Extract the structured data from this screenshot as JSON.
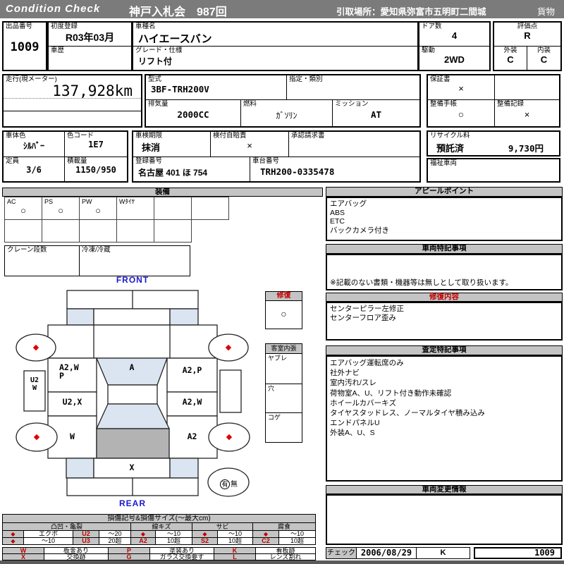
{
  "header": {
    "brand": "Condition  Check",
    "auction": "神戸入札会　987回",
    "pickup": "引取場所：愛知県弥富市五明町二間城",
    "category": "貨物"
  },
  "info": {
    "lot_label": "出品番号",
    "lot_no": "1009",
    "first_reg_label": "初度登録",
    "first_reg": "R03年03月",
    "history_label": "車歴",
    "history": "",
    "model_name_label": "車種名",
    "model_name": "ハイエースバン",
    "grade_label": "グレード・仕様",
    "grade": "リフト付",
    "doors_label": "ドア数",
    "doors": "4",
    "drive_label": "駆動",
    "drive": "2WD",
    "score_label": "評価点",
    "score": "R",
    "exterior_label": "外装",
    "exterior": "C",
    "interior_label": "内装",
    "interior": "C",
    "mileage_label": "走行(現メーター)",
    "mileage": "137,928km",
    "model_code_label": "型式",
    "model_code": "3BF-TRH200V",
    "designation_label": "指定・類別",
    "designation": "",
    "displacement_label": "排気量",
    "displacement": "2000CC",
    "fuel_label": "燃料",
    "fuel": "ｶﾞｿﾘﾝ",
    "transmission_label": "ミッション",
    "transmission": "AT",
    "warranty_label": "保証書",
    "warranty": "×",
    "maintenance_book_label": "整備手帳",
    "maintenance_book": "○",
    "maintenance_record_label": "整備記録",
    "maintenance_record": "×",
    "body_color_label": "車体色",
    "body_color": "ｼﾙﾊﾞｰ",
    "color_code_label": "色コード",
    "color_code": "1E7",
    "inspection_label": "車検期限",
    "inspection": "抹消",
    "insurance_label": "検付自賠責",
    "insurance": "×",
    "approval_label": "承認請求書",
    "approval": "",
    "capacity_label": "定員",
    "capacity": "3/6",
    "load_label": "積載量",
    "load": "1150/950",
    "reg_no_label": "登録番号",
    "reg_no": "名古屋 401 ほ 754",
    "chassis_label": "車台番号",
    "chassis": "TRH200-0335478",
    "recycle_label": "リサイクル料",
    "recycle_status": "預託済",
    "recycle_fee": "9,730円",
    "welfare_label": "福祉車両",
    "welfare": ""
  },
  "equipment": {
    "title": "装備",
    "row1": [
      {
        "label": "AC",
        "value": "○"
      },
      {
        "label": "PS",
        "value": "○"
      },
      {
        "label": "PW",
        "value": "○"
      },
      {
        "label": "Wﾀｲﾔ",
        "value": ""
      },
      {
        "label": "",
        "value": ""
      },
      {
        "label": "",
        "value": ""
      }
    ],
    "crane_label": "クレーン段数",
    "fridge_label": "冷凍/冷蔵"
  },
  "diagram": {
    "front_label": "FRONT",
    "rear_label": "REAR",
    "wheel_mark": "◆",
    "panels": {
      "windshield": "A",
      "front_door_left_line1": "A2,W",
      "front_door_left_line2": "P",
      "front_door_right": "A2,P",
      "rocker_left_line1": "U2",
      "rocker_left_line2": "W",
      "slide_left": "U2,X",
      "slide_right": "A2,W",
      "quarter_left": "W",
      "quarter_right": "A2",
      "rear_center": "X"
    },
    "repair": {
      "title": "修復",
      "value": "○"
    },
    "cabin": {
      "title": "客室内張",
      "row1": "ヤブレ",
      "row2": "穴",
      "row3": "コゲ"
    },
    "lift": {
      "yes": "有",
      "no": "無"
    }
  },
  "right": {
    "appeal": {
      "title": "アピールポイント",
      "lines": [
        "エアバッグ",
        "ABS",
        "ETC",
        "バックカメラ付き"
      ]
    },
    "notes": {
      "title": "車両特記事項",
      "note": "※記載のない書類・機器等は無しとして取り扱います。"
    },
    "repair_detail": {
      "title": "修復内容",
      "lines": [
        "センターピラー左修正",
        "センターフロア歪み"
      ]
    },
    "assessment": {
      "title": "査定特記事項",
      "lines": [
        "エアバッグ運転席のみ",
        "社外ナビ",
        "室内汚れ/スレ",
        "荷物室A、U、リフト付き動作未確認",
        "ホイールカバーキズ",
        "タイヤスタッドレス、ノーマルタイヤ積み込み",
        "エンドパネルU",
        "外装A、U、S"
      ]
    },
    "change_info": {
      "title": "車両変更情報"
    },
    "check": {
      "label": "チェック",
      "date": "2006/08/29",
      "inspector": "K",
      "lot": "1009"
    }
  },
  "legend": {
    "title": "損傷記号&損傷サイズ(〜最大cm)",
    "groups": [
      "凸凹・亀裂",
      "線キズ",
      "サビ",
      "腐食"
    ],
    "rowA": [
      "◆",
      "エクボ",
      "U2",
      "〜20",
      "◆",
      "〜10",
      "◆",
      "〜10",
      "◆",
      "〜10"
    ],
    "rowB": [
      "◆",
      "〜10",
      "U3",
      "20超",
      "A2",
      "10超",
      "S2",
      "10超",
      "C2",
      "10超"
    ],
    "codes_row1": [
      "W",
      "板金あり",
      "P",
      "塗装あり",
      "K",
      "看板跡"
    ],
    "codes_row2": [
      "X",
      "交換跡",
      "G",
      "ガラス交換要す",
      "L",
      "レンズ割れ"
    ]
  }
}
